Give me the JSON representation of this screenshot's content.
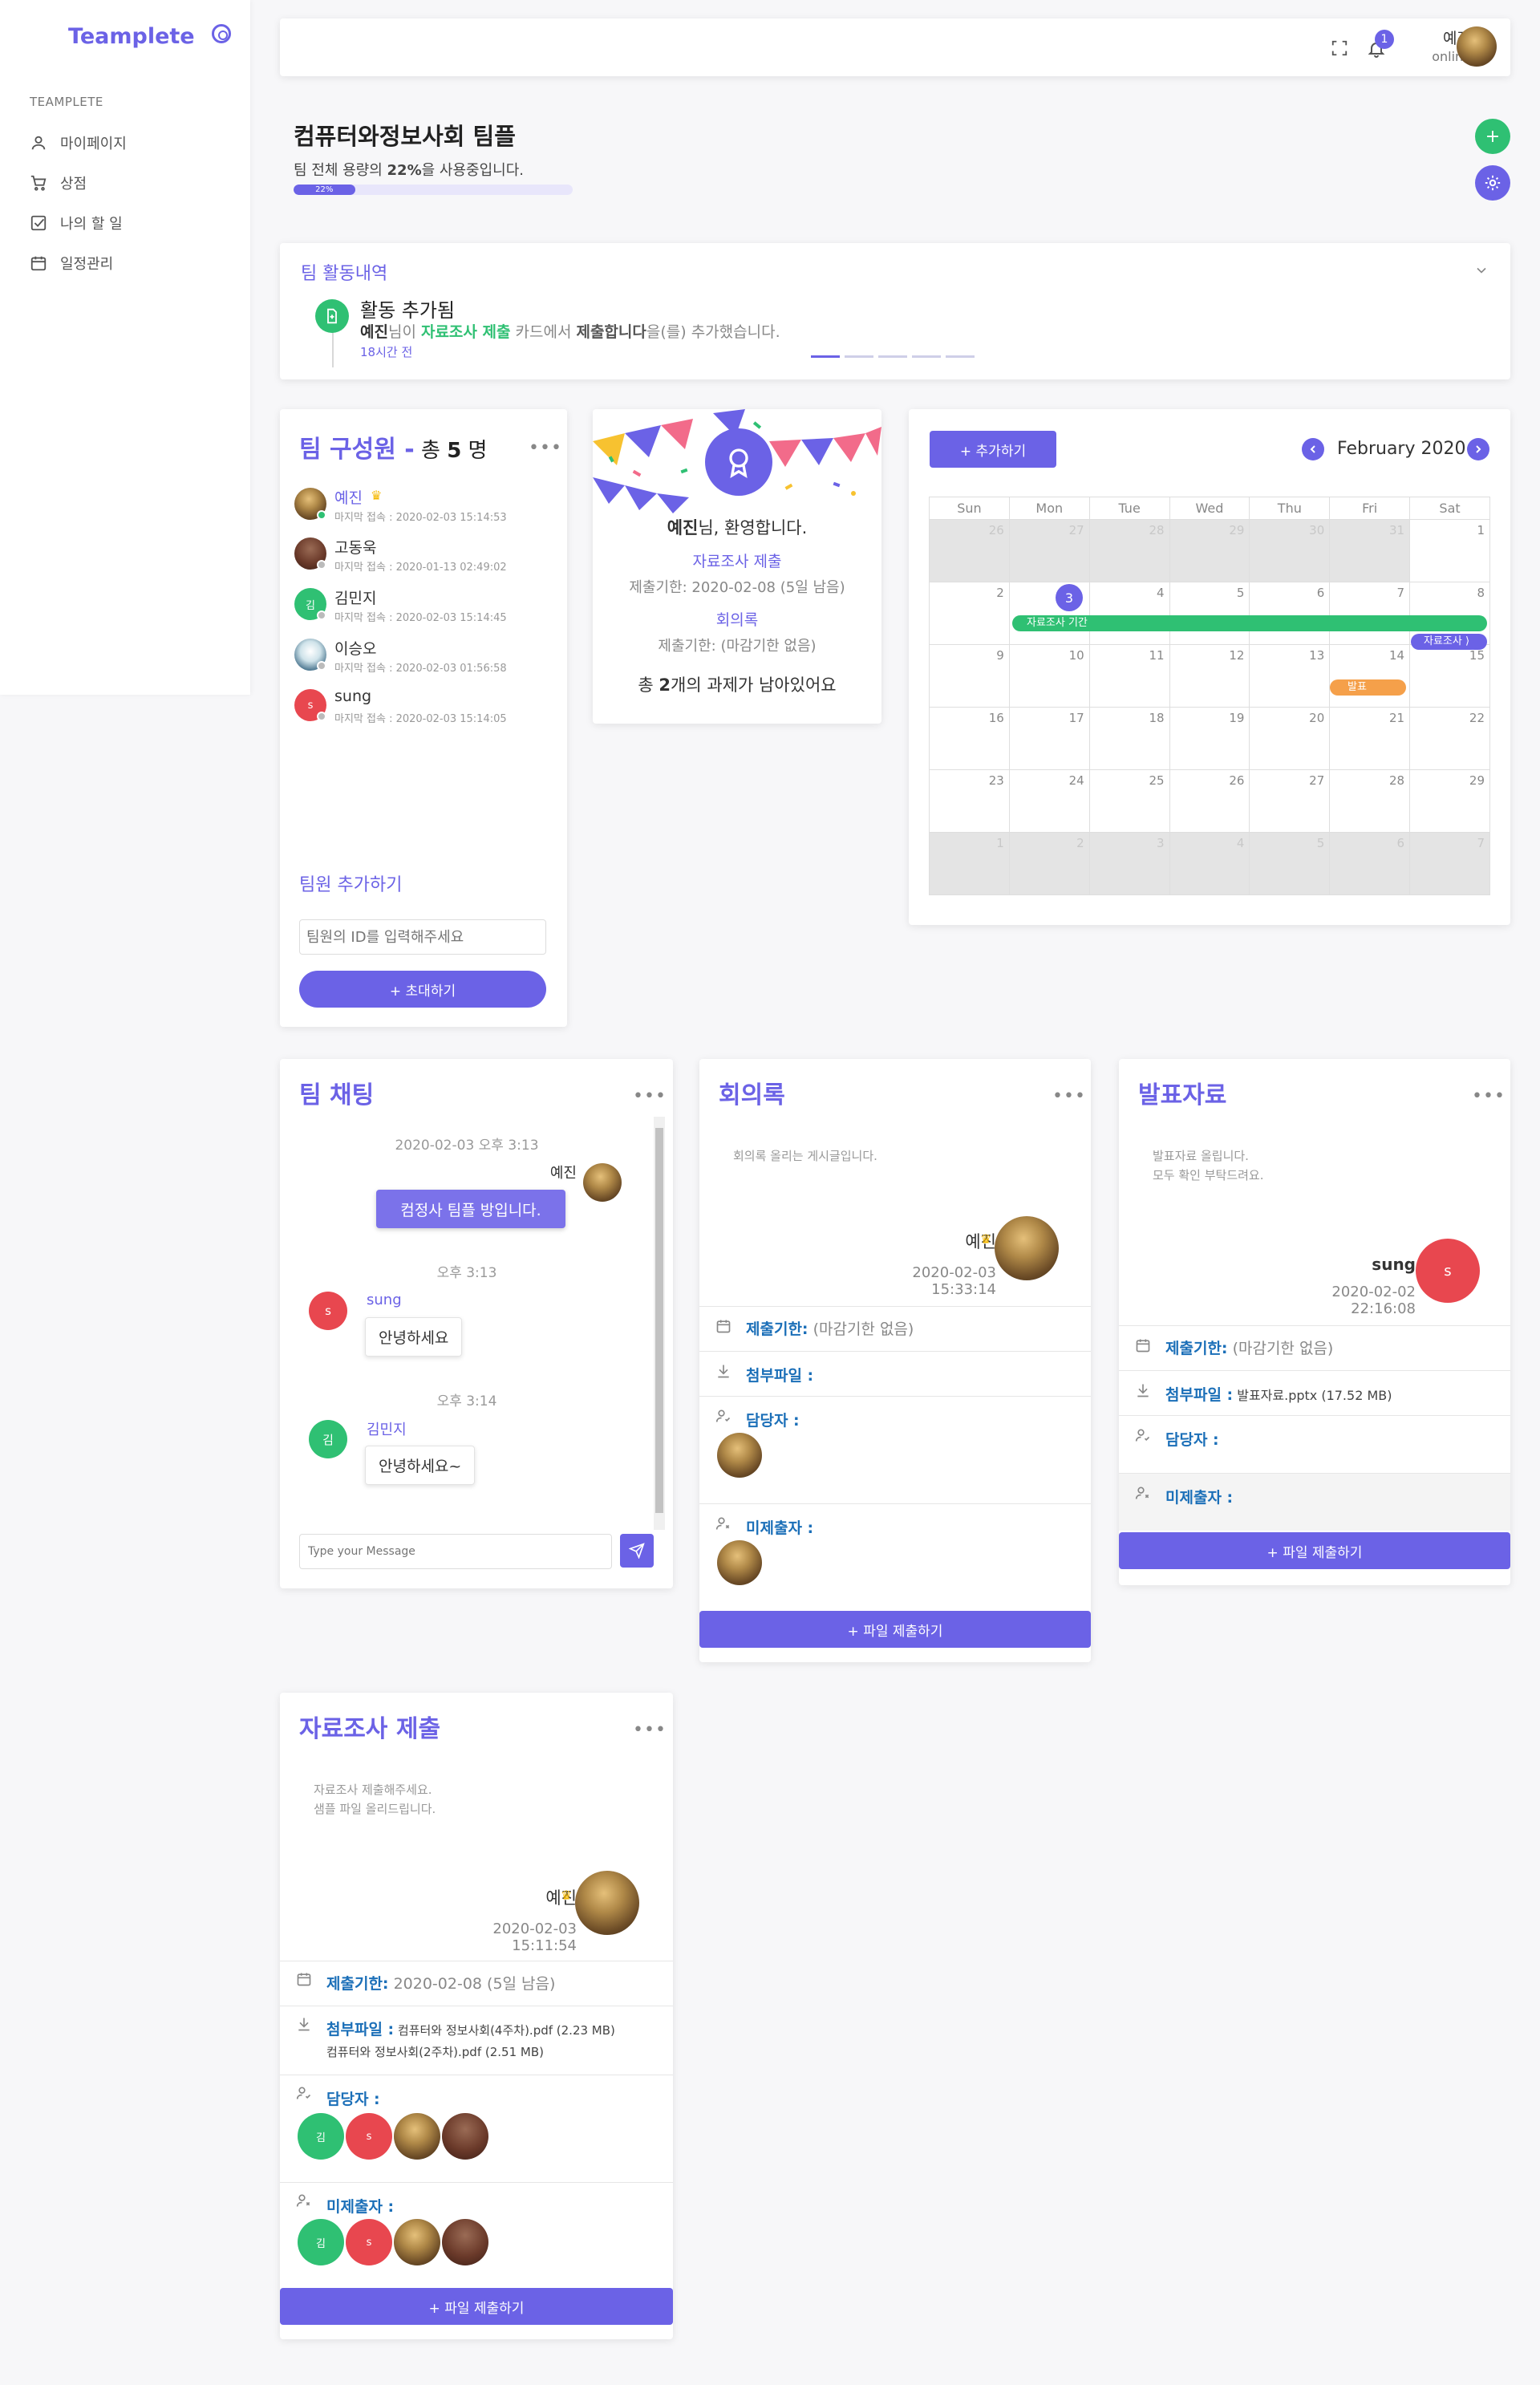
{
  "sidebar": {
    "brand": "Teamplete",
    "section": "TEAMPLETE",
    "items": [
      {
        "label": "마이페이지",
        "icon": "user-icon"
      },
      {
        "label": "상점",
        "icon": "cart-icon"
      },
      {
        "label": "나의 할 일",
        "icon": "checkbox-icon"
      },
      {
        "label": "일정관리",
        "icon": "calendar-icon"
      }
    ]
  },
  "header": {
    "notification_count": "1",
    "user_name": "예진",
    "user_status": "online"
  },
  "team": {
    "title": "컴퓨터와정보사회 팀플",
    "usage_prefix": "팀 전체 용량의 ",
    "usage_value": "22%",
    "usage_suffix": "을 사용중입니다.",
    "usage_bar_label": "22%",
    "usage_fraction": 0.22
  },
  "activity": {
    "title": "팀 활동내역",
    "heading": "활동 추가됨",
    "actor": "예진",
    "t1": "님이 ",
    "item": "자료조사 제출",
    "t2": " 카드에서 ",
    "action": "제출합니다",
    "t3": "을(를) 추가했습니다.",
    "time": "18시간 전"
  },
  "members": {
    "title": "팀 구성원 -",
    "count_prefix": " 총 ",
    "count": "5",
    "count_suffix": " 명",
    "list": [
      {
        "name": "예진",
        "last": "마지막 접속 : 2020-02-03 15:14:53",
        "status": "online"
      },
      {
        "name": "고동욱",
        "last": "마지막 접속 : 2020-01-13 02:49:02",
        "status": "offline"
      },
      {
        "name": "김민지",
        "last": "마지막 접속 : 2020-02-03 15:14:45",
        "status": "offline"
      },
      {
        "name": "이승오",
        "last": "마지막 접속 : 2020-02-03 01:56:58",
        "status": "offline"
      },
      {
        "name": "sung",
        "last": "마지막 접속 : 2020-02-03 15:14:05",
        "status": "offline"
      }
    ],
    "avatar_g": "김",
    "avatar_s": "s",
    "add_title": "팀원 추가하기",
    "input_placeholder": "팀원의 ID를 입력해주세요",
    "invite_button": "+ 초대하기"
  },
  "welcome": {
    "name": "예진",
    "greet": "님, 환영합니다.",
    "task1": "자료조사 제출",
    "task1_due": "제출기한: 2020-02-08 (5일 남음)",
    "task2": "회의록",
    "task2_due": "제출기한: (마감기한 없음)",
    "summary_prefix": "총 ",
    "summary_count": "2",
    "summary_suffix": "개의 과제가 남아있어요"
  },
  "calendar": {
    "add_button": "+ 추가하기",
    "month": "February 2020",
    "weekdays": [
      "Sun",
      "Mon",
      "Tue",
      "Wed",
      "Thu",
      "Fri",
      "Sat"
    ],
    "weeks": [
      [
        [
          "26",
          true
        ],
        [
          "27",
          true
        ],
        [
          "28",
          true
        ],
        [
          "29",
          true
        ],
        [
          "30",
          true
        ],
        [
          "31",
          true
        ],
        [
          "1",
          false
        ]
      ],
      [
        [
          "2",
          false
        ],
        [
          "3",
          false
        ],
        [
          "4",
          false
        ],
        [
          "5",
          false
        ],
        [
          "6",
          false
        ],
        [
          "7",
          false
        ],
        [
          "8",
          false
        ]
      ],
      [
        [
          "9",
          false
        ],
        [
          "10",
          false
        ],
        [
          "11",
          false
        ],
        [
          "12",
          false
        ],
        [
          "13",
          false
        ],
        [
          "14",
          false
        ],
        [
          "15",
          false
        ]
      ],
      [
        [
          "16",
          false
        ],
        [
          "17",
          false
        ],
        [
          "18",
          false
        ],
        [
          "19",
          false
        ],
        [
          "20",
          false
        ],
        [
          "21",
          false
        ],
        [
          "22",
          false
        ]
      ],
      [
        [
          "23",
          false
        ],
        [
          "24",
          false
        ],
        [
          "25",
          false
        ],
        [
          "26",
          false
        ],
        [
          "27",
          false
        ],
        [
          "28",
          false
        ],
        [
          "29",
          false
        ]
      ],
      [
        [
          "1",
          true
        ],
        [
          "2",
          true
        ],
        [
          "3",
          true
        ],
        [
          "4",
          true
        ],
        [
          "5",
          true
        ],
        [
          "6",
          true
        ],
        [
          "7",
          true
        ]
      ]
    ],
    "today": "3",
    "events": [
      {
        "label": "자료조사 기간",
        "color": "#2fc073"
      },
      {
        "label": "자료조사 ⟩",
        "color": "#6b62e6"
      },
      {
        "label": "발표",
        "color": "#f5a04a"
      }
    ]
  },
  "chat": {
    "title": "팀 채팅",
    "date1": "2020-02-03 오후 3:13",
    "me": "예진",
    "msg1": "컴정사 팀플 방입니다.",
    "time2": "오후 3:13",
    "user2": "sung",
    "msg2": "안녕하세요",
    "time3": "오후 3:14",
    "user3": "김민지",
    "msg3": "안녕하세요~",
    "placeholder": "Type your Message",
    "avatar_s": "s",
    "avatar_g": "김"
  },
  "minutes": {
    "title": "회의록",
    "desc": "회의록 올리는 게시글입니다.",
    "author": "예진",
    "date": "2020-02-03 15:33:14",
    "due_label": "제출기한:",
    "due_value": " (마감기한 없음)",
    "files_label": "첨부파일 :",
    "assignee_label": "담당자 :",
    "missing_label": "미제출자 :",
    "submit": "+ 파일 제출하기"
  },
  "presentation": {
    "title": "발표자료",
    "desc1": "발표자료 올립니다.",
    "desc2": "모두 확인 부탁드려요.",
    "author": "sung",
    "avatar": "s",
    "date": "2020-02-02 22:16:08",
    "due_label": "제출기한:",
    "due_value": " (마감기한 없음)",
    "files_label": "첨부파일 :",
    "file": " 발표자료.pptx (17.52 MB)",
    "assignee_label": "담당자 :",
    "missing_label": "미제출자 :",
    "submit": "+ 파일 제출하기"
  },
  "research": {
    "title": "자료조사 제출",
    "desc1": "자료조사 제출해주세요.",
    "desc2": "샘플 파일 올리드립니다.",
    "author": "예진",
    "date": "2020-02-03 15:11:54",
    "due_label": "제출기한:",
    "due_value": " 2020-02-08 (5일 남음)",
    "files_label": "첨부파일 :",
    "file1": " 컴퓨터와 정보사회(4주차).pdf (2.23 MB)",
    "file2": "컴퓨터와 정보사회(2주차).pdf (2.51 MB)",
    "assignee_label": "담당자 :",
    "missing_label": "미제출자 :",
    "avatar_g": "김",
    "avatar_s": "s",
    "submit": "+ 파일 제출하기"
  }
}
